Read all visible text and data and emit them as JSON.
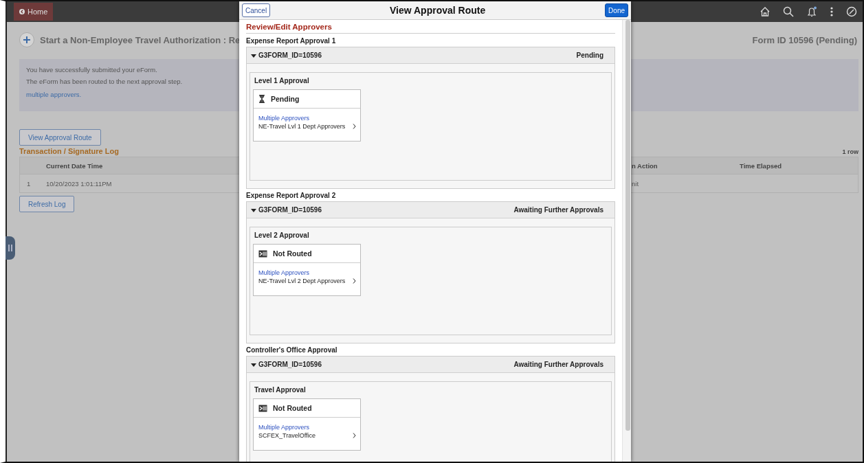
{
  "header": {
    "home_button": "Home",
    "notification_badge": true
  },
  "page": {
    "title": "Start a Non-Employee Travel Authorization : Re",
    "form_id": "Form ID 10596 (Pending)"
  },
  "message": {
    "lines": [
      "You have successfully submitted your eForm.",
      "The eForm has been routed to the next approval step."
    ],
    "link": "multiple approvers."
  },
  "view_route_button": "View Approval Route",
  "log": {
    "title": "Transaction / Signature Log",
    "row_count": "1 row",
    "columns": [
      "Current Date Time",
      "n Action",
      "Time Elapsed"
    ],
    "rows": [
      {
        "number": "1",
        "date_time": "10/20/2023 1:01:11PM",
        "action": "nit"
      }
    ]
  },
  "refresh_button": "Refresh Log",
  "dialog": {
    "title": "View Approval Route",
    "cancel": "Cancel",
    "done": "Done",
    "heading": "Review/Edit Approvers",
    "sections": [
      {
        "label": "Expense Report Approval 1",
        "form_id": "G3FORM_ID=10596",
        "status": "Pending",
        "expanded": true,
        "stage": "Level 1 Approval",
        "step": {
          "kind": "pending",
          "status": "Pending",
          "link": "Multiple Approvers",
          "approver": "NE-Travel Lvl 1 Dept Approvers"
        }
      },
      {
        "label": "Expense Report Approval 2",
        "form_id": "G3FORM_ID=10596",
        "status": "Awaiting Further Approvals",
        "expanded": true,
        "stage": "Level 2 Approval",
        "step": {
          "kind": "not_routed",
          "status": "Not Routed",
          "link": "Multiple Approvers",
          "approver": "NE-Travel Lvl 2 Dept Approvers"
        }
      },
      {
        "label": "Controller's Office Approval",
        "form_id": "G3FORM_ID=10596",
        "status": "Awaiting Further Approvals",
        "expanded": true,
        "stage": "Travel Approval",
        "step": {
          "kind": "not_routed",
          "status": "Not Routed",
          "link": "Multiple Approvers",
          "approver": "SCFEX_TravelOffice"
        }
      }
    ]
  }
}
